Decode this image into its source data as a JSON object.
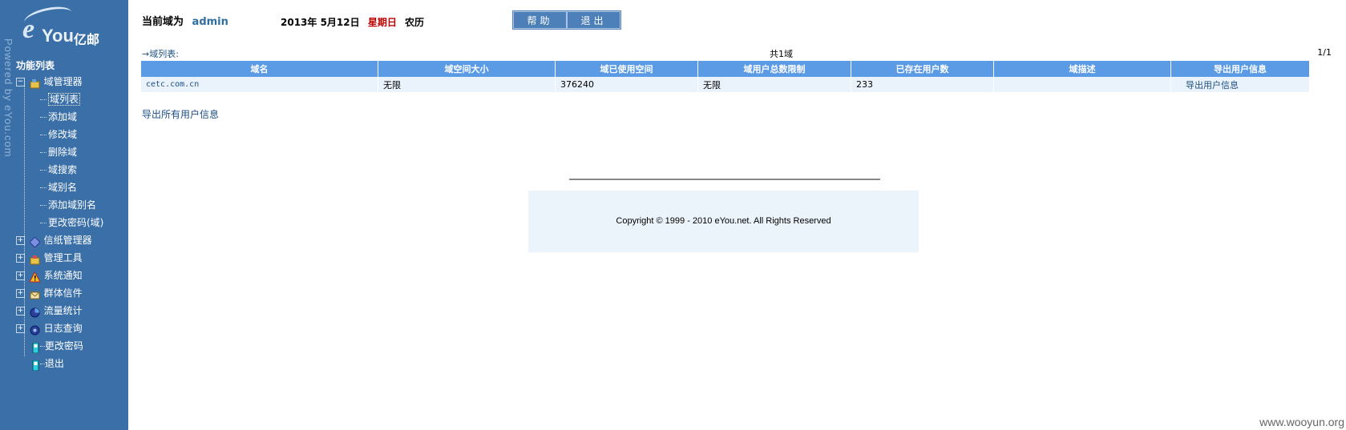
{
  "brand": {
    "vertical_text": "Powered by eYou.com",
    "logo_mark": "eYou",
    "logo_cn": "亿邮"
  },
  "sidebar": {
    "title": "功能列表",
    "domain_manager": {
      "label": "域管理器",
      "children": [
        "域列表",
        "添加域",
        "修改域",
        "删除域",
        "域搜索",
        "域别名",
        "添加域别名",
        "更改密码(域)"
      ]
    },
    "items": [
      {
        "label": "信纸管理器",
        "icon": "diamond-icon"
      },
      {
        "label": "管理工具",
        "icon": "tools-icon"
      },
      {
        "label": "系统通知",
        "icon": "warning-icon"
      },
      {
        "label": "群体信件",
        "icon": "group-mail-icon"
      },
      {
        "label": "流量统计",
        "icon": "stats-icon"
      },
      {
        "label": "日志查询",
        "icon": "log-icon"
      }
    ],
    "leaf_items": [
      {
        "label": "更改密码",
        "icon": "phone-icon"
      },
      {
        "label": "退出",
        "icon": "phone-icon"
      }
    ]
  },
  "header": {
    "current_domain_label": "当前域为",
    "current_user": "admin",
    "date": "2013年  5月12日",
    "weekday": "星期日",
    "calendar": "农历",
    "help_button": "帮助",
    "logout_button": "退出"
  },
  "domain_list": {
    "caption": "→域列表:",
    "total": "共1域",
    "page": "1/1",
    "columns": [
      "域名",
      "域空间大小",
      "域已使用空间",
      "域用户总数限制",
      "已存在用户数",
      "域描述",
      "导出用户信息"
    ],
    "rows": [
      {
        "domain": "cetc.com.cn",
        "space": "无限",
        "used": "376240",
        "user_limit": "无限",
        "user_count": "233",
        "description": "",
        "export": "导出用户信息"
      }
    ],
    "export_all": "导出所有用户信息"
  },
  "footer": {
    "copyright": "Copyright © 1999 - 2010 eYou.net. All Rights Reserved"
  },
  "watermark": "www.wooyun.org",
  "colors": {
    "sidebar_bg": "#3a6fa8",
    "table_header_bg": "#5b9be6",
    "table_row_bg": "#eaf2fb",
    "weekday_red": "#c00000",
    "link_blue": "#1d4f82"
  }
}
